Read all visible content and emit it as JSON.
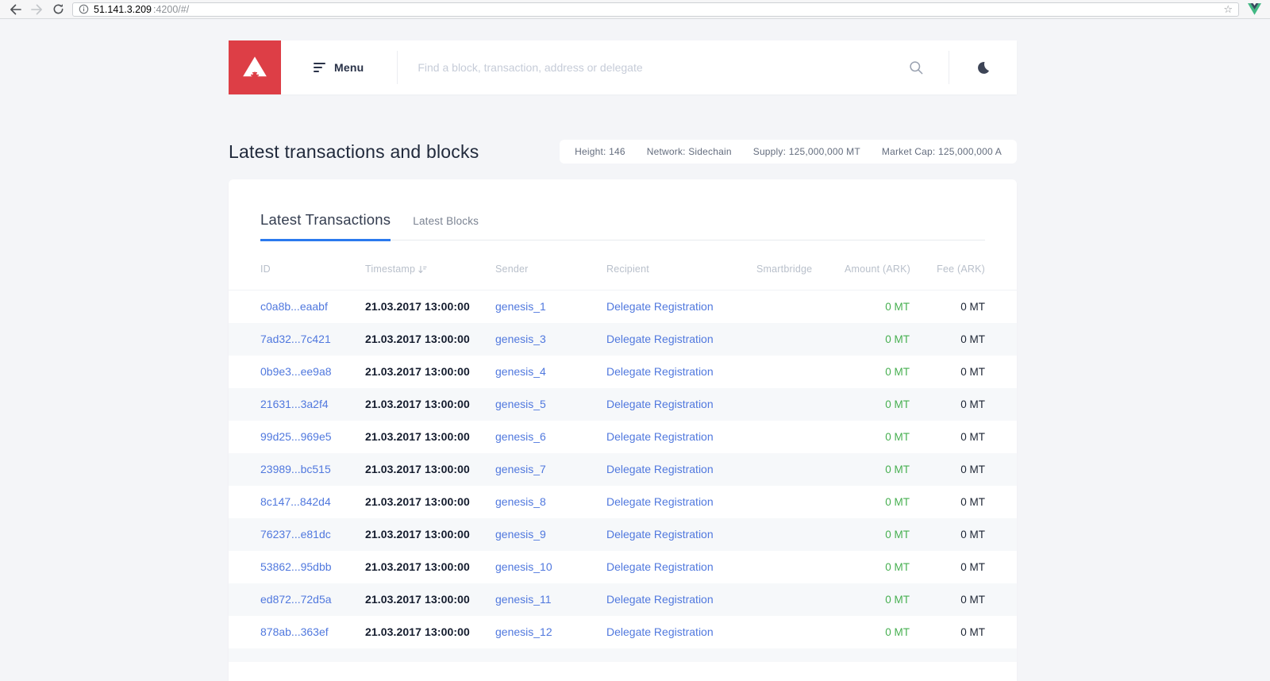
{
  "browser": {
    "url_host": "51.141.3.209",
    "url_path": ":4200/#/",
    "star_glyph": "☆"
  },
  "nav": {
    "menu_label": "Menu",
    "search_placeholder": "Find a block, transaction, address or delegate"
  },
  "page": {
    "title": "Latest transactions and blocks",
    "stats": [
      "Height: 146",
      "Network: Sidechain",
      "Supply: 125,000,000 MT",
      "Market Cap: 125,000,000 A"
    ]
  },
  "tabs": {
    "transactions": "Latest Transactions",
    "blocks": "Latest Blocks"
  },
  "table": {
    "columns": [
      "ID",
      "Timestamp",
      "Sender",
      "Recipient",
      "Smartbridge",
      "Amount (ARK)",
      "Fee (ARK)"
    ],
    "rows": [
      {
        "id": "c0a8b...eaabf",
        "timestamp": "21.03.2017 13:00:00",
        "sender": "genesis_1",
        "recipient": "Delegate Registration",
        "smartbridge": "",
        "amount": "0 MT",
        "fee": "0 MT"
      },
      {
        "id": "7ad32...7c421",
        "timestamp": "21.03.2017 13:00:00",
        "sender": "genesis_3",
        "recipient": "Delegate Registration",
        "smartbridge": "",
        "amount": "0 MT",
        "fee": "0 MT"
      },
      {
        "id": "0b9e3...ee9a8",
        "timestamp": "21.03.2017 13:00:00",
        "sender": "genesis_4",
        "recipient": "Delegate Registration",
        "smartbridge": "",
        "amount": "0 MT",
        "fee": "0 MT"
      },
      {
        "id": "21631...3a2f4",
        "timestamp": "21.03.2017 13:00:00",
        "sender": "genesis_5",
        "recipient": "Delegate Registration",
        "smartbridge": "",
        "amount": "0 MT",
        "fee": "0 MT"
      },
      {
        "id": "99d25...969e5",
        "timestamp": "21.03.2017 13:00:00",
        "sender": "genesis_6",
        "recipient": "Delegate Registration",
        "smartbridge": "",
        "amount": "0 MT",
        "fee": "0 MT"
      },
      {
        "id": "23989...bc515",
        "timestamp": "21.03.2017 13:00:00",
        "sender": "genesis_7",
        "recipient": "Delegate Registration",
        "smartbridge": "",
        "amount": "0 MT",
        "fee": "0 MT"
      },
      {
        "id": "8c147...842d4",
        "timestamp": "21.03.2017 13:00:00",
        "sender": "genesis_8",
        "recipient": "Delegate Registration",
        "smartbridge": "",
        "amount": "0 MT",
        "fee": "0 MT"
      },
      {
        "id": "76237...e81dc",
        "timestamp": "21.03.2017 13:00:00",
        "sender": "genesis_9",
        "recipient": "Delegate Registration",
        "smartbridge": "",
        "amount": "0 MT",
        "fee": "0 MT"
      },
      {
        "id": "53862...95dbb",
        "timestamp": "21.03.2017 13:00:00",
        "sender": "genesis_10",
        "recipient": "Delegate Registration",
        "smartbridge": "",
        "amount": "0 MT",
        "fee": "0 MT"
      },
      {
        "id": "ed872...72d5a",
        "timestamp": "21.03.2017 13:00:00",
        "sender": "genesis_11",
        "recipient": "Delegate Registration",
        "smartbridge": "",
        "amount": "0 MT",
        "fee": "0 MT"
      },
      {
        "id": "878ab...363ef",
        "timestamp": "21.03.2017 13:00:00",
        "sender": "genesis_12",
        "recipient": "Delegate Registration",
        "smartbridge": "",
        "amount": "0 MT",
        "fee": "0 MT"
      }
    ]
  },
  "colors": {
    "brand_red": "#dd3e46",
    "link_blue": "#5078de",
    "tab_underline_blue": "#2b79ee",
    "amount_green": "#46af50",
    "page_background": "#f4f5f8"
  }
}
